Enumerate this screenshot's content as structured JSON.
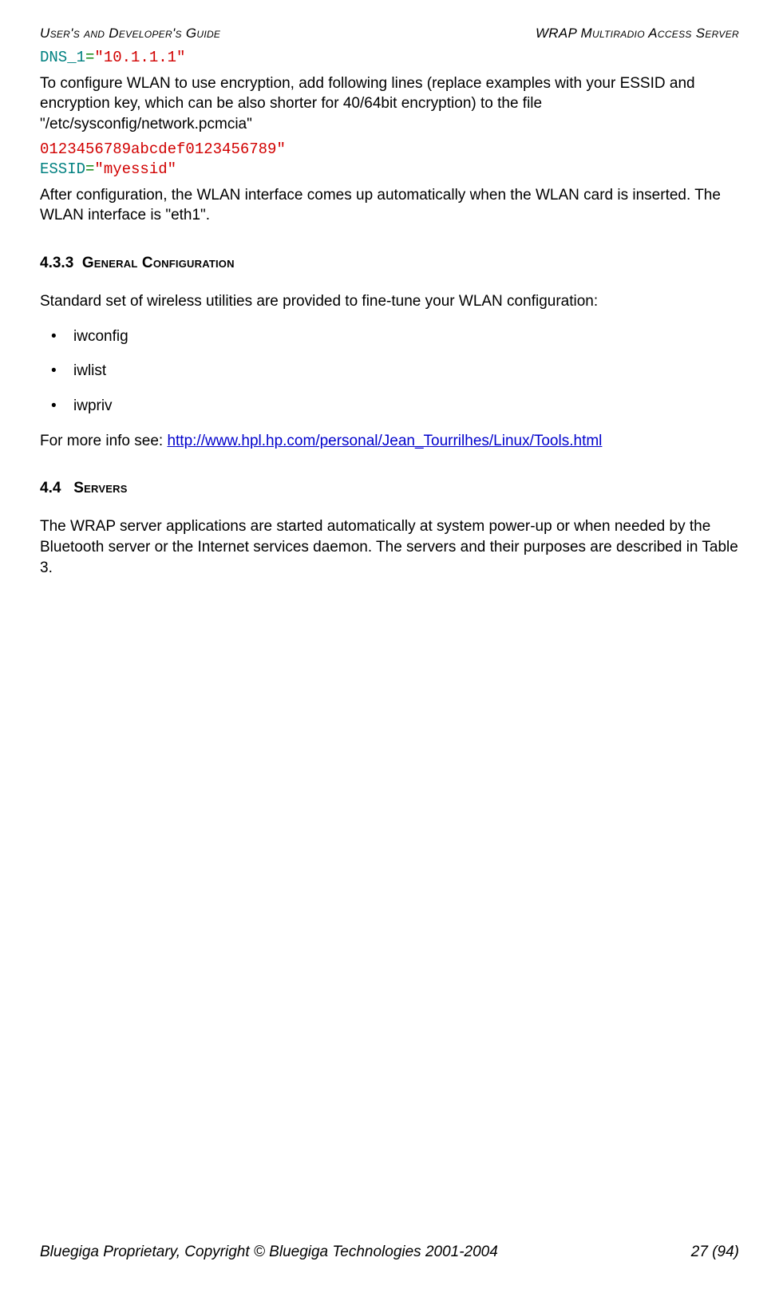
{
  "header": {
    "left": "User's and Developer's Guide",
    "right": "WRAP Multiradio Access Server"
  },
  "code_block_1": {
    "line1_a": "DNS_1",
    "line1_b": "=",
    "line1_c": "\"10.1.1.1\""
  },
  "para1": "To configure WLAN to use encryption, add following lines (replace examples with your ESSID and encryption key, which can be also shorter for 40/64bit encryption) to the file \"/etc/sysconfig/network.pcmcia\"",
  "code_block_2": {
    "line1": "0123456789abcdef0123456789\"",
    "line2_a": "ESSID",
    "line2_b": "=",
    "line2_c": "\"myessid\""
  },
  "para2": "After configuration, the WLAN interface comes up automatically when the WLAN card is inserted. The WLAN interface is \"eth1\".",
  "sec433_num": "4.3.3",
  "sec433_title": "General Configuration",
  "para3": "Standard set of wireless utilities are provided to fine-tune your WLAN configuration:",
  "bullets": [
    "iwconfig",
    "iwlist",
    "iwpriv"
  ],
  "para4_prefix": "For more info see: ",
  "para4_link_text": "http://www.hpl.hp.com/personal/Jean_Tourrilhes/Linux/Tools.html",
  "para4_link_href": "http://www.hpl.hp.com/personal/Jean_Tourrilhes/Linux/Tools.html",
  "sec44_num": "4.4",
  "sec44_title": "Servers",
  "para5": "The WRAP server applications are started automatically at system power-up or when needed by the Bluetooth server or the Internet services daemon. The servers and their purposes are described in Table 3.",
  "footer": {
    "left": "Bluegiga Proprietary, Copyright © Bluegiga Technologies 2001-2004",
    "right": "27 (94)"
  }
}
